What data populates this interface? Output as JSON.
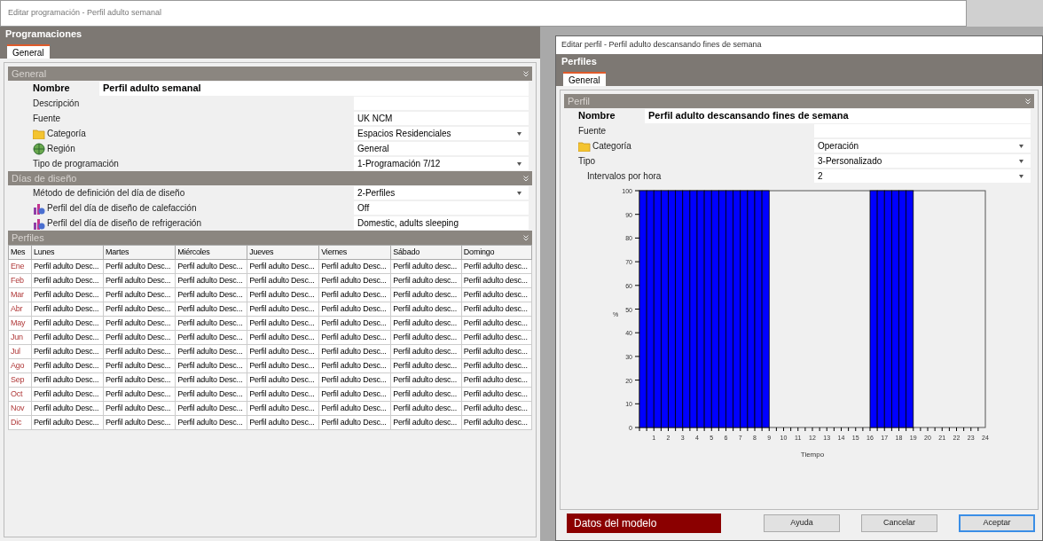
{
  "main_window": {
    "title": "Editar programación - Perfil adulto semanal",
    "header": "Programaciones",
    "tabs": [
      {
        "label": "General",
        "selected": true
      }
    ],
    "sections": [
      {
        "title": "General",
        "fields": [
          {
            "kind": "name",
            "label": "Nombre",
            "value": "Perfil adulto semanal"
          },
          {
            "kind": "text",
            "label": "Descripción"
          },
          {
            "kind": "text",
            "label": "Fuente",
            "value": "UK NCM"
          },
          {
            "kind": "category",
            "label": "Categoría",
            "value": "Espacios Residenciales"
          },
          {
            "kind": "region",
            "label": "Región",
            "value": "General"
          },
          {
            "kind": "dropdown",
            "label": "Tipo de programación",
            "value": "1-Programación 7/12"
          }
        ]
      },
      {
        "title": "Días de diseño",
        "fields": [
          {
            "kind": "dropdown",
            "label": "Método de definición del día de diseño",
            "value": "2-Perfiles"
          },
          {
            "kind": "profile",
            "label": "Perfil del día de diseño de calefacción",
            "value": "Off"
          },
          {
            "kind": "profile",
            "label": "Perfil del día de diseño de refrigeración",
            "value": "Domestic, adults sleeping"
          }
        ]
      }
    ],
    "profiles": {
      "title": "Perfiles",
      "columns": [
        "Mes",
        "Lunes",
        "Martes",
        "Miércoles",
        "Jueves",
        "Viernes",
        "Sábado",
        "Domingo"
      ],
      "rows": [
        [
          "Ene",
          "Perfil adulto Desc...",
          "Perfil adulto Desc...",
          "Perfil adulto Desc...",
          "Perfil adulto Desc...",
          "Perfil adulto Desc...",
          "Perfil adulto desc...",
          "Perfil adulto desc..."
        ],
        [
          "Feb",
          "Perfil adulto Desc...",
          "Perfil adulto Desc...",
          "Perfil adulto Desc...",
          "Perfil adulto Desc...",
          "Perfil adulto Desc...",
          "Perfil adulto desc...",
          "Perfil adulto desc..."
        ],
        [
          "Mar",
          "Perfil adulto Desc...",
          "Perfil adulto Desc...",
          "Perfil adulto Desc...",
          "Perfil adulto Desc...",
          "Perfil adulto Desc...",
          "Perfil adulto desc...",
          "Perfil adulto desc..."
        ],
        [
          "Abr",
          "Perfil adulto Desc...",
          "Perfil adulto Desc...",
          "Perfil adulto Desc...",
          "Perfil adulto Desc...",
          "Perfil adulto Desc...",
          "Perfil adulto desc...",
          "Perfil adulto desc..."
        ],
        [
          "May",
          "Perfil adulto Desc...",
          "Perfil adulto Desc...",
          "Perfil adulto Desc...",
          "Perfil adulto Desc...",
          "Perfil adulto Desc...",
          "Perfil adulto desc...",
          "Perfil adulto desc..."
        ],
        [
          "Jun",
          "Perfil adulto Desc...",
          "Perfil adulto Desc...",
          "Perfil adulto Desc...",
          "Perfil adulto Desc...",
          "Perfil adulto Desc...",
          "Perfil adulto desc...",
          "Perfil adulto desc..."
        ],
        [
          "Jul",
          "Perfil adulto Desc...",
          "Perfil adulto Desc...",
          "Perfil adulto Desc...",
          "Perfil adulto Desc...",
          "Perfil adulto Desc...",
          "Perfil adulto desc...",
          "Perfil adulto desc..."
        ],
        [
          "Ago",
          "Perfil adulto Desc...",
          "Perfil adulto Desc...",
          "Perfil adulto Desc...",
          "Perfil adulto Desc...",
          "Perfil adulto Desc...",
          "Perfil adulto desc...",
          "Perfil adulto desc..."
        ],
        [
          "Sep",
          "Perfil adulto Desc...",
          "Perfil adulto Desc...",
          "Perfil adulto Desc...",
          "Perfil adulto Desc...",
          "Perfil adulto Desc...",
          "Perfil adulto desc...",
          "Perfil adulto desc..."
        ],
        [
          "Oct",
          "Perfil adulto Desc...",
          "Perfil adulto Desc...",
          "Perfil adulto Desc...",
          "Perfil adulto Desc...",
          "Perfil adulto Desc...",
          "Perfil adulto desc...",
          "Perfil adulto desc..."
        ],
        [
          "Nov",
          "Perfil adulto Desc...",
          "Perfil adulto Desc...",
          "Perfil adulto Desc...",
          "Perfil adulto Desc...",
          "Perfil adulto Desc...",
          "Perfil adulto desc...",
          "Perfil adulto desc..."
        ],
        [
          "Dic",
          "Perfil adulto Desc...",
          "Perfil adulto Desc...",
          "Perfil adulto Desc...",
          "Perfil adulto Desc...",
          "Perfil adulto Desc...",
          "Perfil adulto desc...",
          "Perfil adulto desc..."
        ]
      ]
    }
  },
  "profile_dialog": {
    "title": "Editar perfil - Perfil adulto descansando fines de semana",
    "header": "Perfiles",
    "tabs": [
      {
        "label": "General",
        "selected": true
      }
    ],
    "section": {
      "title": "Perfil",
      "fields": [
        {
          "kind": "name",
          "label": "Nombre",
          "value": "Perfil adulto descansando fines de semana"
        },
        {
          "kind": "text",
          "label": "Fuente"
        },
        {
          "kind": "category",
          "label": "Categoría",
          "value": "Operación"
        },
        {
          "kind": "dropdown",
          "label": "Tipo",
          "value": "3-Personalizado"
        },
        {
          "kind": "sub-dropdown",
          "label": "Intervalos por hora",
          "value": "2"
        }
      ]
    },
    "chart_data": {
      "type": "bar",
      "xlabel": "Tiempo",
      "ylabel": "%",
      "x": [
        0.25,
        0.75,
        1.25,
        1.75,
        2.25,
        2.75,
        3.25,
        3.75,
        4.25,
        4.75,
        5.25,
        5.75,
        6.25,
        6.75,
        7.25,
        7.75,
        8.25,
        8.75,
        9.25,
        9.75,
        10.25,
        10.75,
        11.25,
        11.75,
        12.25,
        12.75,
        13.25,
        13.75,
        14.25,
        14.75,
        15.25,
        15.75,
        16.25,
        16.75,
        17.25,
        17.75,
        18.25,
        18.75,
        19.25,
        19.75,
        20.25,
        20.75,
        21.25,
        21.75,
        22.25,
        22.75,
        23.25,
        23.75
      ],
      "values": [
        100,
        100,
        100,
        100,
        100,
        100,
        100,
        100,
        100,
        100,
        100,
        100,
        100,
        100,
        100,
        100,
        100,
        100,
        0,
        0,
        0,
        0,
        0,
        0,
        0,
        0,
        0,
        0,
        0,
        0,
        0,
        0,
        100,
        100,
        100,
        100,
        100,
        100,
        0,
        0,
        0,
        0,
        0,
        0,
        0,
        0,
        0,
        0
      ],
      "xlim": [
        0,
        24
      ],
      "ylim": [
        0,
        100
      ],
      "xticks": [
        1,
        2,
        3,
        4,
        5,
        6,
        7,
        8,
        9,
        10,
        11,
        12,
        13,
        14,
        15,
        16,
        17,
        18,
        19,
        20,
        21,
        22,
        23,
        24
      ],
      "yticks": [
        0,
        10,
        20,
        30,
        40,
        50,
        60,
        70,
        80,
        90,
        100
      ]
    },
    "model_data_label": "Datos del modelo",
    "buttons": [
      {
        "label": "Ayuda",
        "default": false
      },
      {
        "label": "Cancelar",
        "default": false
      },
      {
        "label": "Aceptar",
        "default": true
      }
    ]
  }
}
